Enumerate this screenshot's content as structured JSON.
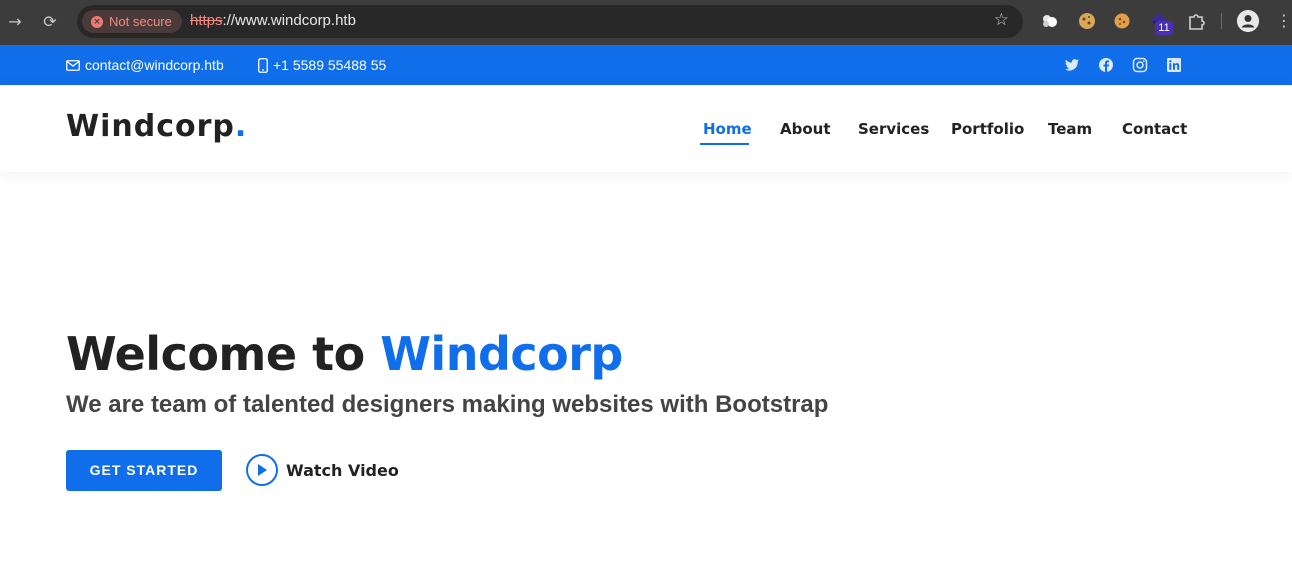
{
  "browser": {
    "security_label": "Not secure",
    "url_scheme": "https",
    "url_rest": "://www.windcorp.htb",
    "extension_badge": "11",
    "icons": [
      "back-arrow-icon",
      "reload-icon",
      "star-icon",
      "cloud-extension-icon",
      "cookie-extension-icon",
      "cookie-editor-icon",
      "hat-extension-icon",
      "puzzle-icon",
      "profile-icon",
      "kebab-menu-icon"
    ]
  },
  "topbar": {
    "email": "contact@windcorp.htb",
    "phone": "+1 5589 55488 55",
    "social": [
      "twitter-icon",
      "facebook-icon",
      "instagram-icon",
      "linkedin-icon"
    ],
    "color": "#106eea"
  },
  "header": {
    "logo_text": "Windcorp",
    "logo_dot": ".",
    "nav": [
      {
        "label": "Home",
        "active": true
      },
      {
        "label": "About",
        "active": false
      },
      {
        "label": "Services",
        "active": false
      },
      {
        "label": "Portfolio",
        "active": false
      },
      {
        "label": "Team",
        "active": false
      },
      {
        "label": "Contact",
        "active": false
      }
    ]
  },
  "hero": {
    "title_prefix": "Welcome to ",
    "title_accent": "Windcorp",
    "subtitle": "We are team of talented designers making websites with Bootstrap",
    "cta_label": "GET STARTED",
    "video_label": "Watch Video",
    "accent_color": "#106eea"
  }
}
